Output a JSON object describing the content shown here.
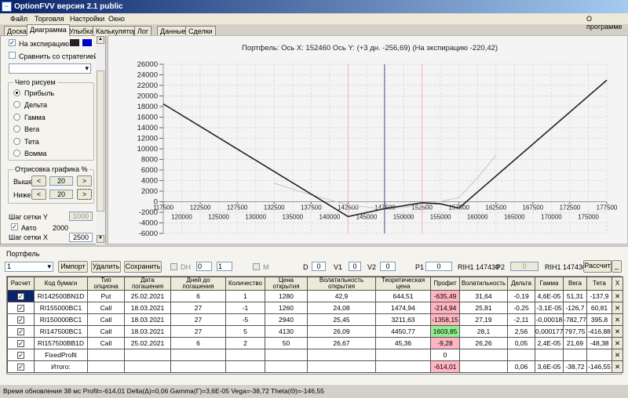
{
  "window": {
    "title": "OptionFVV версия 2.1 public",
    "icon": "app-icon"
  },
  "menu": {
    "items": [
      "Файл",
      "Торговля",
      "Настройки",
      "Окно"
    ],
    "about": "О программе"
  },
  "tabs": [
    "Доска",
    "Диаграмма",
    "Улыбка",
    "Калькулятор",
    "Лог",
    "Данные",
    "Сделки"
  ],
  "left": {
    "expiry_label": "На экспирацию",
    "expiry_checked": true,
    "expiry_colors": [
      "#222222",
      "#0000cc"
    ],
    "compare_label": "Сравнить со стратегией",
    "what_group": "Чего рисуем",
    "radios": [
      "Прибыль",
      "Дельта",
      "Гамма",
      "Вега",
      "Тета",
      "Вомма"
    ],
    "render_group": "Отрисовка графика %",
    "above_label": "Выше",
    "above_value": "20",
    "below_label": "Ниже",
    "below_value": "20",
    "prev": "<",
    "next": ">",
    "grid_y_label": "Шаг сетки Y",
    "grid_y_value": "1000",
    "auto_label": "Авто",
    "auto_value": "2000",
    "grid_x_label": "Шаг сетки X",
    "grid_x_value": "2500"
  },
  "chart_data": {
    "type": "line",
    "title": "Портфель: Ось X: 152460 Ось Y: (+3 дн. -256,69) (На экспирацию -220,42)",
    "xlim": [
      117500,
      177500
    ],
    "ylim": [
      -6000,
      26000
    ],
    "yticks": [
      26000,
      24000,
      22000,
      20000,
      18000,
      16000,
      14000,
      12000,
      10000,
      8000,
      6000,
      4000,
      2000,
      0,
      -2000,
      -4000,
      -6000
    ],
    "xticks_upper": [
      117500,
      122500,
      127500,
      132500,
      137500,
      142500,
      147500,
      152500,
      157500,
      162500,
      167500,
      172500,
      177500
    ],
    "xticks_lower": [
      120000,
      125000,
      130000,
      135000,
      140000,
      145000,
      150000,
      155000,
      160000,
      165000,
      170000,
      175000
    ],
    "grid": true,
    "vlines": [
      {
        "x": 142500,
        "color": "#ffb0b8"
      },
      {
        "x": 147430,
        "color": "#4a5a8a"
      },
      {
        "x": 152500,
        "color": "#ffb0b8"
      }
    ],
    "series": [
      {
        "name": "expiry",
        "color": "#222222",
        "x": [
          117500,
          142500,
          147500,
          152500,
          155000,
          157500,
          177500
        ],
        "y": [
          18500,
          -2800,
          -1300,
          -200,
          -400,
          -1200,
          23000
        ]
      },
      {
        "name": "+3 дн.",
        "color": "#cccccc",
        "x": [
          132500,
          137500,
          142500,
          147500,
          152500,
          157500,
          160000,
          162500
        ],
        "y": [
          3500,
          1300,
          -600,
          -1400,
          -700,
          800,
          4500,
          8800
        ]
      }
    ]
  },
  "portfolio": {
    "group": "Портфель",
    "selector": "1",
    "import": "Импорт",
    "delete": "Удалить",
    "save": "Сохранить",
    "dh": "DH",
    "spin1": "0",
    "spin2": "1",
    "m": "M",
    "d_label": "D",
    "d": "0",
    "v1_label": "V1",
    "v1": "0",
    "v2_label": "V2",
    "v2": "0",
    "p1_label": "P1",
    "p1": "0",
    "p1_ref": "RIH1 147430",
    "p2_label": "P2",
    "p2": "0",
    "p2_ref": "RIH1 147430",
    "calc": "Рассчит",
    "minimize": "_",
    "headers": [
      "Расчет",
      "Код бумаги",
      "Тип опциона",
      "Дата погашения",
      "Дней до погашения",
      "Количество",
      "Цена открытия",
      "Волатильность открытия",
      "Теоретическая цена",
      "Профит",
      "Волатильность",
      "Дельта",
      "Гамма",
      "Вега",
      "Тета",
      "X"
    ],
    "rows": [
      {
        "code": "RI142500BN1D",
        "type": "Put",
        "date": "25.02.2021",
        "days": "6",
        "qty": "1",
        "price": "1280",
        "vol_open": "42,9",
        "theor": "644,51",
        "profit": "-635,49",
        "pc": "neg",
        "vol": "31,64",
        "delta": "-0,19",
        "gamma": "4,6E-05",
        "vega": "51,31",
        "theta": "-137,9"
      },
      {
        "code": "RI155000BC1",
        "type": "Call",
        "date": "18.03.2021",
        "days": "27",
        "qty": "-1",
        "price": "1260",
        "vol_open": "24,08",
        "theor": "1474,94",
        "profit": "-214,94",
        "pc": "neg",
        "vol": "25,81",
        "delta": "-0,25",
        "gamma": "-3,1E-05",
        "vega": "-126,7",
        "theta": "60,81"
      },
      {
        "code": "RI150000BC1",
        "type": "Call",
        "date": "18.03.2021",
        "days": "27",
        "qty": "-5",
        "price": "2940",
        "vol_open": "25,45",
        "theor": "3211,63",
        "profit": "-1358,15",
        "pc": "neg",
        "vol": "27,19",
        "delta": "-2,11",
        "gamma": "-0,00018",
        "vega": "-782,77",
        "theta": "395,8"
      },
      {
        "code": "RI147500BC1",
        "type": "Call",
        "date": "18.03.2021",
        "days": "27",
        "qty": "5",
        "price": "4130",
        "vol_open": "26,09",
        "theor": "4450,77",
        "profit": "1603,85",
        "pc": "pos",
        "vol": "28,1",
        "delta": "2,56",
        "gamma": "0,000177",
        "vega": "797,75",
        "theta": "-416,88"
      },
      {
        "code": "RI157500BB1D",
        "type": "Call",
        "date": "25.02.2021",
        "days": "6",
        "qty": "2",
        "price": "50",
        "vol_open": "26,67",
        "theor": "45,36",
        "profit": "-9,28",
        "pc": "neg",
        "vol": "26,26",
        "delta": "0,05",
        "gamma": "2,4E-05",
        "vega": "21,69",
        "theta": "-48,38"
      },
      {
        "code": "FixedProfit",
        "type": "",
        "date": "",
        "days": "",
        "qty": "",
        "price": "",
        "vol_open": "",
        "theor": "",
        "profit": "0",
        "pc": "",
        "vol": "",
        "delta": "",
        "gamma": "",
        "vega": "",
        "theta": ""
      },
      {
        "code": "Итого:",
        "type": "",
        "date": "",
        "days": "",
        "qty": "",
        "price": "",
        "vol_open": "",
        "theor": "",
        "profit": "-614,01",
        "pc": "neg",
        "vol": "",
        "delta": "0,06",
        "gamma": "3,6E-05",
        "vega": "-38,72",
        "theta": "-146,55"
      }
    ]
  },
  "status": "Время обновления 38 мс  Profit=-614,01 Delta(Δ)=0,06 Gamma(Γ)=3,6E-05 Vega=-38,72 Theta(Θ)=-146,55"
}
